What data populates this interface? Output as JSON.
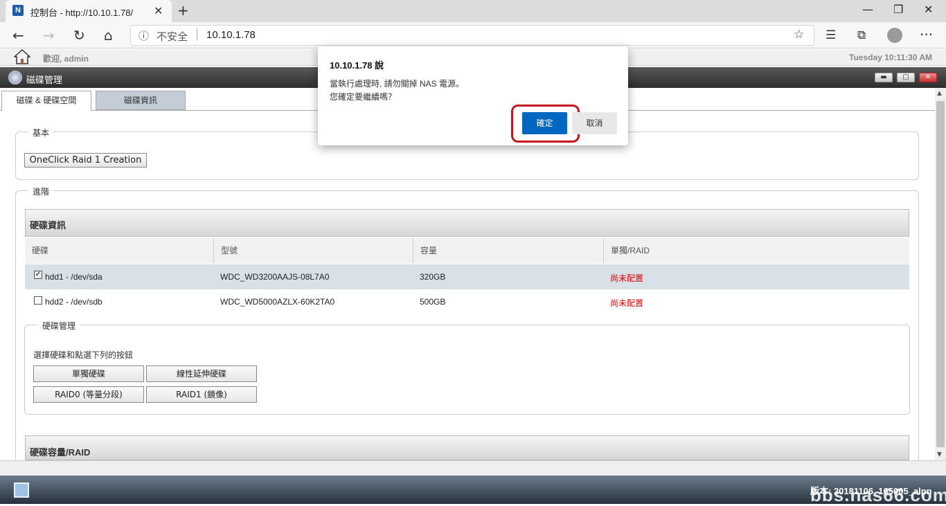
{
  "browser": {
    "tab_title": "控制台 - http://10.10.1.78/",
    "favicon_letter": "N",
    "insecure_label": "不安全",
    "url": "10.10.1.78"
  },
  "nas": {
    "welcome": "歡迎, admin",
    "datetime": "Tuesday 10:11:30 AM",
    "window_title": "磁碟管理",
    "tabs": [
      "磁碟 & 硬碟空間",
      "磁碟資訊"
    ],
    "basic_legend": "基本",
    "oneclick_label": "OneClick Raid 1 Creation",
    "advanced_legend": "進階",
    "disk_info_header": "硬碟資訊",
    "columns": [
      "硬碟",
      "型號",
      "容量",
      "單獨/RAID"
    ],
    "disks": [
      {
        "name": "hdd1 - /dev/sda",
        "model": "WDC_WD3200AAJS-08L7A0",
        "capacity": "320GB",
        "status": "尚未配置",
        "checked": true
      },
      {
        "name": "hdd2 - /dev/sdb",
        "model": "WDC_WD5000AZLX-60K2TA0",
        "capacity": "500GB",
        "status": "尚未配置",
        "checked": false
      }
    ],
    "disk_mgmt_legend": "硬碟管理",
    "disk_mgmt_hint": "選擇硬碟和點選下列的按鈕",
    "buttons": {
      "single": "單獨硬碟",
      "linear": "線性延伸硬碟",
      "raid0": "RAID0 (等量分段)",
      "raid1": "RAID1 (鏡像)"
    },
    "capacity_header": "硬碟容量/RAID",
    "version": "版本: 20181106_165005_alpn"
  },
  "dialog": {
    "title": "10.10.1.78 說",
    "message_line1": "當執行處理時, 請勿關掉 NAS 電源。",
    "message_line2": "您確定要繼續嗎？",
    "ok_label": "確定",
    "cancel_label": "取消"
  },
  "watermark": "bbs.nas66.com"
}
